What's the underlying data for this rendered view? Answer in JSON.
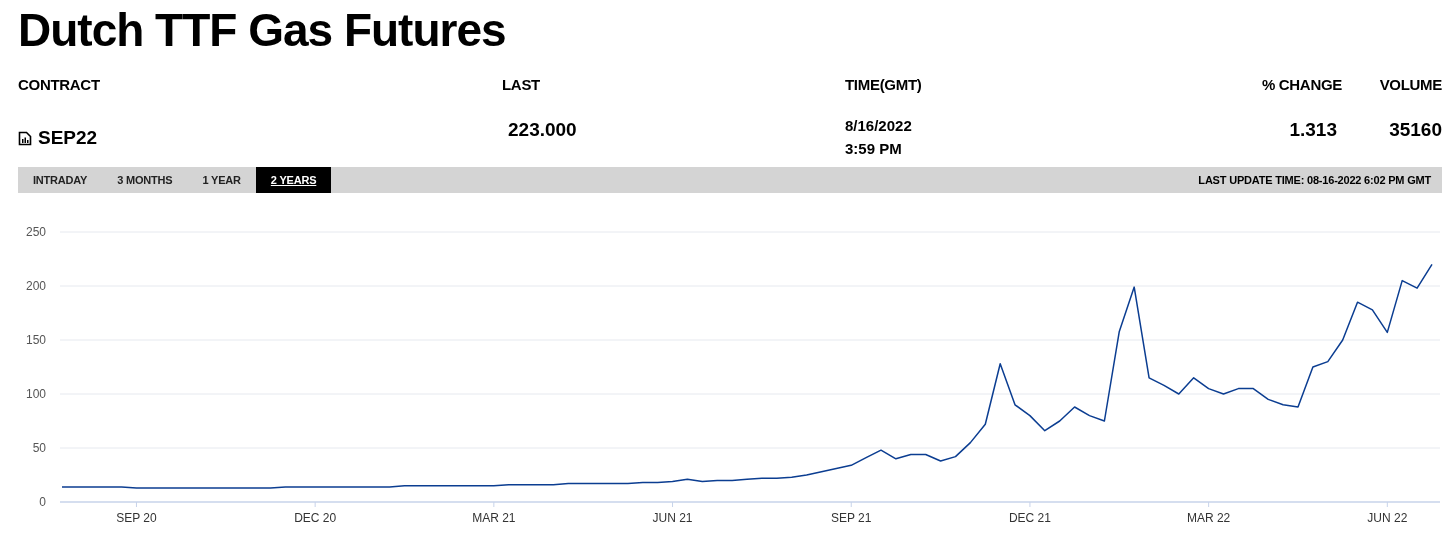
{
  "title": "Dutch TTF Gas Futures",
  "columns": [
    "CONTRACT",
    "LAST",
    "TIME(GMT)",
    "% CHANGE",
    "VOLUME"
  ],
  "row": {
    "contract": "SEP22",
    "last": "223.000",
    "date": "8/16/2022",
    "time": "3:59 PM",
    "change": "1.313",
    "volume": "35160"
  },
  "tabs": [
    {
      "label": "INTRADAY",
      "selected": false
    },
    {
      "label": "3 MONTHS",
      "selected": false
    },
    {
      "label": "1 YEAR",
      "selected": false
    },
    {
      "label": "2 YEARS",
      "selected": true
    }
  ],
  "last_update": "LAST UPDATE TIME: 08-16-2022 6:02 PM GMT",
  "chart_data": {
    "type": "line",
    "grid": true,
    "ylim": [
      0,
      250
    ],
    "yticks": [
      0,
      50,
      100,
      150,
      200,
      250
    ],
    "categories": [
      null,
      null,
      null,
      null,
      null,
      "SEP 20",
      null,
      null,
      null,
      null,
      null,
      null,
      null,
      null,
      null,
      null,
      null,
      "DEC 20",
      null,
      null,
      null,
      null,
      null,
      null,
      null,
      null,
      null,
      null,
      null,
      "MAR 21",
      null,
      null,
      null,
      null,
      null,
      null,
      null,
      null,
      null,
      null,
      null,
      "JUN 21",
      null,
      null,
      null,
      null,
      null,
      null,
      null,
      null,
      null,
      null,
      null,
      "SEP 21",
      null,
      null,
      null,
      null,
      null,
      null,
      null,
      null,
      null,
      null,
      null,
      "DEC 21",
      null,
      null,
      null,
      null,
      null,
      null,
      null,
      null,
      null,
      null,
      null,
      "MAR 22",
      null,
      null,
      null,
      null,
      null,
      null,
      null,
      null,
      null,
      null,
      null,
      "JUN 22",
      null,
      null,
      null
    ],
    "series": [
      {
        "color": "#0b3d91",
        "values": [
          14,
          14,
          14,
          14,
          14,
          13,
          13,
          13,
          13,
          13,
          13,
          13,
          13,
          13,
          13,
          14,
          14,
          14,
          14,
          14,
          14,
          14,
          14,
          15,
          15,
          15,
          15,
          15,
          15,
          15,
          16,
          16,
          16,
          16,
          17,
          17,
          17,
          17,
          17,
          18,
          18,
          19,
          21,
          19,
          20,
          20,
          21,
          22,
          22,
          23,
          25,
          28,
          31,
          34,
          41,
          48,
          40,
          44,
          44,
          38,
          42,
          55,
          72,
          128,
          90,
          80,
          66,
          75,
          88,
          80,
          75,
          158,
          199,
          115,
          108,
          100,
          115,
          105,
          100,
          105,
          105,
          95,
          90,
          88,
          125,
          130,
          150,
          185,
          178,
          157,
          205,
          198,
          220
        ]
      }
    ]
  }
}
